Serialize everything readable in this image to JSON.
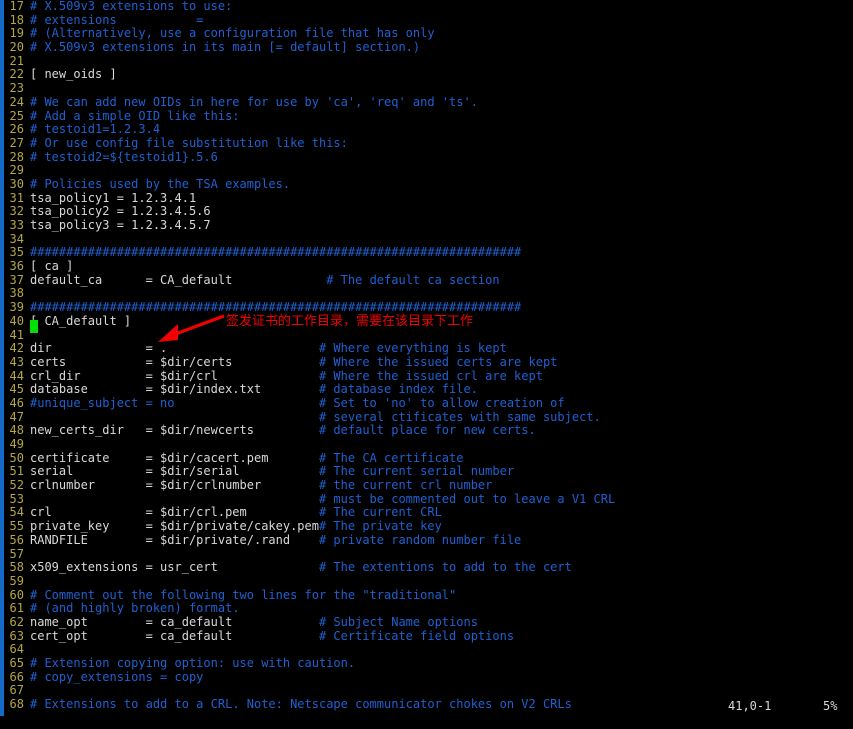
{
  "terminal": {
    "app": "vim",
    "background_color": "#000000",
    "left_rail_color": "#1569c7",
    "cursor_color": "#00e000",
    "cursor_line": 41,
    "colors": {
      "line_number": "#b5a642",
      "comment": "#2060d0",
      "text": "#d8d8d8",
      "annotation": "#f00000"
    }
  },
  "annotation": {
    "text": "签发证书的工作目录，需要在该目录下工作",
    "arrow": "red-arrow-pointing-down-left",
    "color": "#f00000"
  },
  "statusline": {
    "position": "41,0-1",
    "percent": "5%"
  },
  "editor": {
    "lines": [
      {
        "n": "17",
        "text": "# X.509v3 extensions to use:",
        "style": "comment"
      },
      {
        "n": "18",
        "text": "# extensions           =",
        "style": "comment"
      },
      {
        "n": "19",
        "text": "# (Alternatively, use a configuration file that has only",
        "style": "comment"
      },
      {
        "n": "20",
        "text": "# X.509v3 extensions in its main [= default] section.)",
        "style": "comment"
      },
      {
        "n": "21",
        "text": "",
        "style": "plain"
      },
      {
        "n": "22",
        "text": "[ new_oids ]",
        "style": "plain"
      },
      {
        "n": "23",
        "text": "",
        "style": "plain"
      },
      {
        "n": "24",
        "text": "# We can add new OIDs in here for use by 'ca', 'req' and 'ts'.",
        "style": "comment"
      },
      {
        "n": "25",
        "text": "# Add a simple OID like this:",
        "style": "comment"
      },
      {
        "n": "26",
        "text": "# testoid1=1.2.3.4",
        "style": "comment"
      },
      {
        "n": "27",
        "text": "# Or use config file substitution like this:",
        "style": "comment"
      },
      {
        "n": "28",
        "text": "# testoid2=${testoid1}.5.6",
        "style": "comment"
      },
      {
        "n": "29",
        "text": "",
        "style": "plain"
      },
      {
        "n": "30",
        "text": "# Policies used by the TSA examples.",
        "style": "comment"
      },
      {
        "n": "31",
        "text": "tsa_policy1 = 1.2.3.4.1",
        "style": "plain"
      },
      {
        "n": "32",
        "text": "tsa_policy2 = 1.2.3.4.5.6",
        "style": "plain"
      },
      {
        "n": "33",
        "text": "tsa_policy3 = 1.2.3.4.5.7",
        "style": "plain"
      },
      {
        "n": "34",
        "text": "",
        "style": "plain"
      },
      {
        "n": "35",
        "text": "####################################################################",
        "style": "comment"
      },
      {
        "n": "36",
        "text": "[ ca ]",
        "style": "plain"
      },
      {
        "n": "37",
        "text": "default_ca      = CA_default             # The default ca section",
        "style": "split",
        "code": "default_ca      = CA_default             ",
        "comment": "# The default ca section"
      },
      {
        "n": "38",
        "text": "",
        "style": "plain"
      },
      {
        "n": "39",
        "text": "####################################################################",
        "style": "comment"
      },
      {
        "n": "40",
        "text": "[ CA_default ]",
        "style": "plain"
      },
      {
        "n": "41",
        "text": "",
        "style": "plain"
      },
      {
        "n": "42",
        "text": "dir             = .                     # Where everything is kept",
        "style": "split",
        "code": "dir             = .                     ",
        "comment": "# Where everything is kept"
      },
      {
        "n": "43",
        "text": "certs           = $dir/certs            # Where the issued certs are kept",
        "style": "split",
        "code": "certs           = $dir/certs            ",
        "comment": "# Where the issued certs are kept"
      },
      {
        "n": "44",
        "text": "crl_dir         = $dir/crl              # Where the issued crl are kept",
        "style": "split",
        "code": "crl_dir         = $dir/crl              ",
        "comment": "# Where the issued crl are kept"
      },
      {
        "n": "45",
        "text": "database        = $dir/index.txt        # database index file.",
        "style": "split",
        "code": "database        = $dir/index.txt        ",
        "comment": "# database index file."
      },
      {
        "n": "46",
        "text": "#unique_subject = no                    # Set to 'no' to allow creation of",
        "style": "comment"
      },
      {
        "n": "47",
        "text": "                                        # several ctificates with same subject.",
        "style": "split",
        "code": "                                        ",
        "comment": "# several ctificates with same subject."
      },
      {
        "n": "48",
        "text": "new_certs_dir   = $dir/newcerts         # default place for new certs.",
        "style": "split",
        "code": "new_certs_dir   = $dir/newcerts         ",
        "comment": "# default place for new certs."
      },
      {
        "n": "49",
        "text": "",
        "style": "plain"
      },
      {
        "n": "50",
        "text": "certificate     = $dir/cacert.pem       # The CA certificate",
        "style": "split",
        "code": "certificate     = $dir/cacert.pem       ",
        "comment": "# The CA certificate"
      },
      {
        "n": "51",
        "text": "serial          = $dir/serial           # The current serial number",
        "style": "split",
        "code": "serial          = $dir/serial           ",
        "comment": "# The current serial number"
      },
      {
        "n": "52",
        "text": "crlnumber       = $dir/crlnumber        # the current crl number",
        "style": "split",
        "code": "crlnumber       = $dir/crlnumber        ",
        "comment": "# the current crl number"
      },
      {
        "n": "53",
        "text": "                                        # must be commented out to leave a V1 CRL",
        "style": "split",
        "code": "                                        ",
        "comment": "# must be commented out to leave a V1 CRL"
      },
      {
        "n": "54",
        "text": "crl             = $dir/crl.pem          # The current CRL",
        "style": "split",
        "code": "crl             = $dir/crl.pem          ",
        "comment": "# The current CRL"
      },
      {
        "n": "55",
        "text": "private_key     = $dir/private/cakey.pem# The private key",
        "style": "split",
        "code": "private_key     = $dir/private/cakey.pem",
        "comment": "# The private key"
      },
      {
        "n": "56",
        "text": "RANDFILE        = $dir/private/.rand    # private random number file",
        "style": "split",
        "code": "RANDFILE        = $dir/private/.rand    ",
        "comment": "# private random number file"
      },
      {
        "n": "57",
        "text": "",
        "style": "plain"
      },
      {
        "n": "58",
        "text": "x509_extensions = usr_cert              # The extentions to add to the cert",
        "style": "split",
        "code": "x509_extensions = usr_cert              ",
        "comment": "# The extentions to add to the cert"
      },
      {
        "n": "59",
        "text": "",
        "style": "plain"
      },
      {
        "n": "60",
        "text": "# Comment out the following two lines for the \"traditional\"",
        "style": "comment"
      },
      {
        "n": "61",
        "text": "# (and highly broken) format.",
        "style": "comment"
      },
      {
        "n": "62",
        "text": "name_opt        = ca_default            # Subject Name options",
        "style": "split",
        "code": "name_opt        = ca_default            ",
        "comment": "# Subject Name options"
      },
      {
        "n": "63",
        "text": "cert_opt        = ca_default            # Certificate field options",
        "style": "split",
        "code": "cert_opt        = ca_default            ",
        "comment": "# Certificate field options"
      },
      {
        "n": "64",
        "text": "",
        "style": "plain"
      },
      {
        "n": "65",
        "text": "# Extension copying option: use with caution.",
        "style": "comment"
      },
      {
        "n": "66",
        "text": "# copy_extensions = copy",
        "style": "comment"
      },
      {
        "n": "67",
        "text": "",
        "style": "plain"
      },
      {
        "n": "68",
        "text": "# Extensions to add to a CRL. Note: Netscape communicator chokes on V2 CRLs",
        "style": "comment"
      }
    ]
  }
}
